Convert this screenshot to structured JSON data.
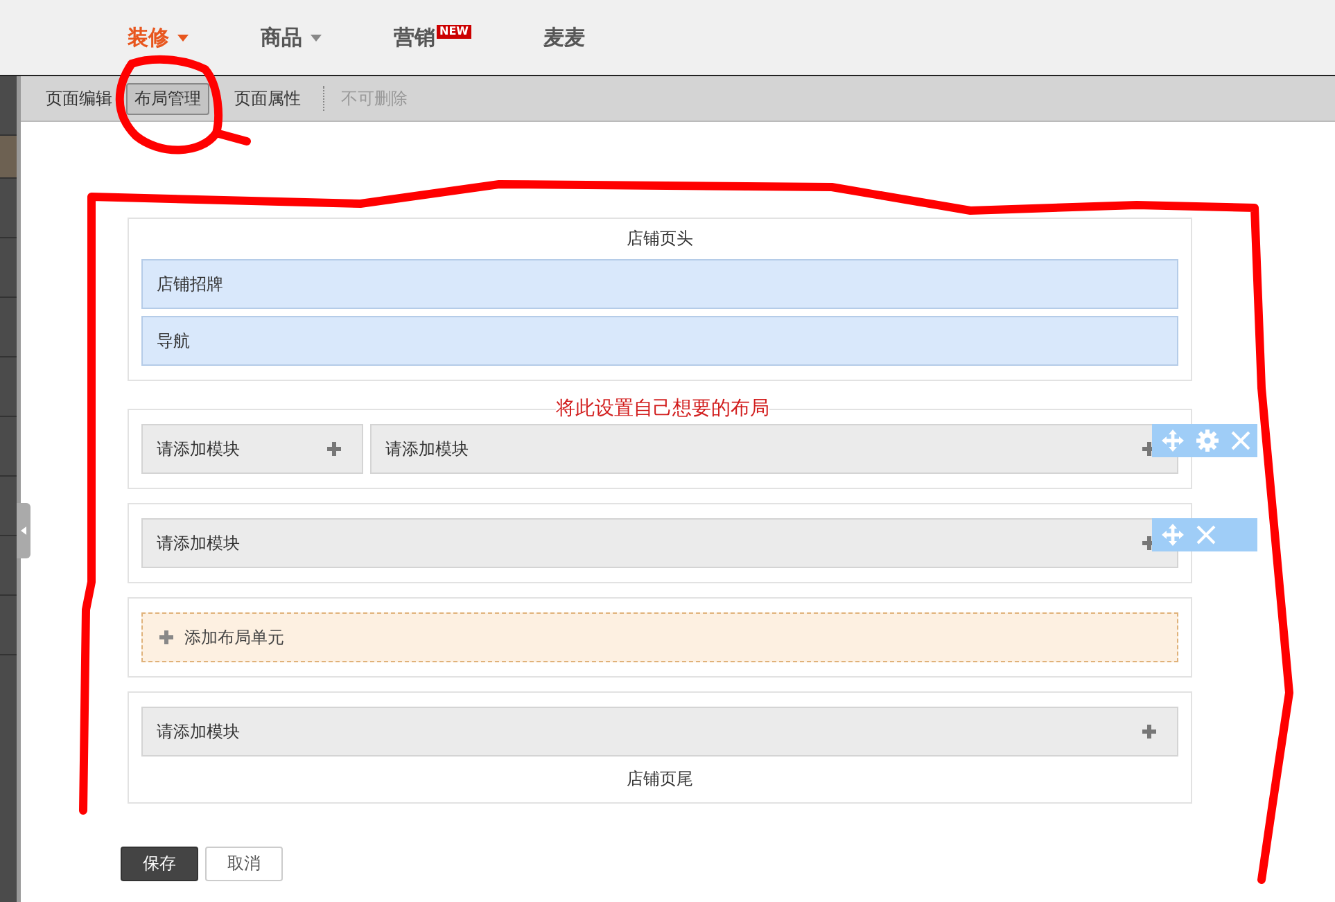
{
  "top_nav": [
    {
      "label": "装修",
      "selected": true,
      "caret": true
    },
    {
      "label": "商品",
      "selected": false,
      "caret": true
    },
    {
      "label": "营销",
      "selected": false,
      "badge": "NEW"
    },
    {
      "label": "麦麦",
      "selected": false
    }
  ],
  "toolbar": {
    "tabs": [
      {
        "label": "页面编辑",
        "selected": false
      },
      {
        "label": "布局管理",
        "selected": true
      },
      {
        "label": "页面属性",
        "selected": false
      }
    ],
    "disabled_action": "不可删除"
  },
  "annotation": "将此设置自己想要的布局",
  "sections": [
    {
      "kind": "header",
      "title": "店铺页头",
      "bars": [
        "店铺招牌",
        "导航"
      ]
    },
    {
      "kind": "row",
      "modules": [
        "请添加模块",
        "请添加模块"
      ],
      "tools": [
        {
          "kind": "move"
        },
        {
          "kind": "settings"
        },
        {
          "kind": "close"
        }
      ]
    },
    {
      "kind": "row",
      "modules": [
        "请添加模块"
      ],
      "tools": [
        {
          "kind": "move"
        },
        {
          "kind": "close"
        }
      ]
    },
    {
      "kind": "add",
      "label": "添加布局单元"
    },
    {
      "kind": "footer",
      "title": "店铺页尾",
      "modules": [
        "请添加模块"
      ]
    }
  ],
  "buttons": [
    {
      "label": "保存",
      "kind": "primary"
    },
    {
      "label": "取消",
      "kind": "secondary"
    }
  ]
}
